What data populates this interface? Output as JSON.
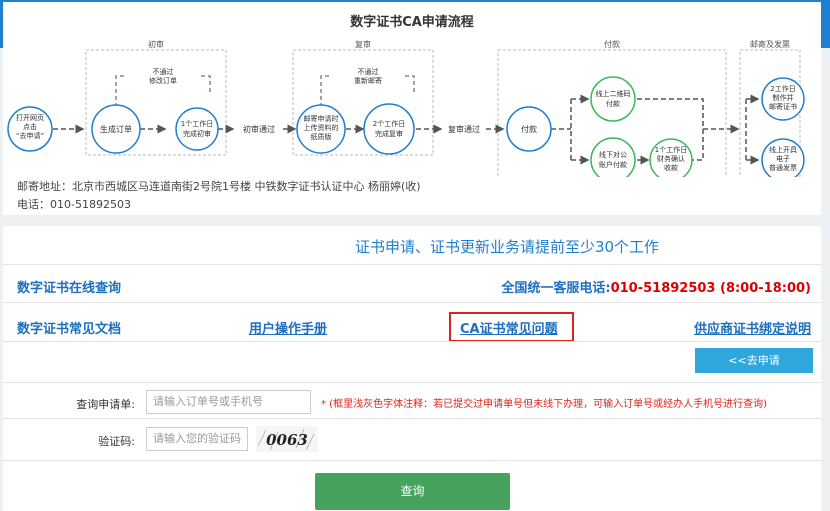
{
  "flow": {
    "title": "数字证书CA申请流程",
    "stages": {
      "first_review": "初审",
      "second_review": "复审",
      "payment": "付款",
      "mail": "邮寄及发票"
    },
    "start": [
      "打开网页",
      "点击",
      "“去申请”"
    ],
    "generate_order": "生成订单",
    "first_loop": [
      "不通过",
      "修改订单"
    ],
    "first_done": [
      "1个工作日",
      "完成初审"
    ],
    "first_pass": "初审通过",
    "mail_docs": [
      "邮寄申请时",
      "上传资料的",
      "纸质版"
    ],
    "second_loop": [
      "不通过",
      "重新邮寄"
    ],
    "second_done": [
      "2个工作日",
      "完成复审"
    ],
    "second_pass": "复审通过",
    "pay": "付款",
    "pay_online": [
      "线上二维码",
      "付款"
    ],
    "pay_offline": [
      "线下对公",
      "账户付款"
    ],
    "pay_confirm": [
      "1个工作日",
      "财务确认",
      "收款"
    ],
    "make_cert": [
      "2工作日",
      "制作并",
      "邮寄证书"
    ],
    "invoice": [
      "线上开具",
      "电子",
      "普通发票"
    ]
  },
  "address": {
    "line1": "邮寄地址：北京市西城区马连道南街2号院1号楼    中铁数字证书认证中心    杨丽婷(收)",
    "line2": "电话：010-51892503"
  },
  "notice": "证书申请、证书更新业务请提前至少30个工作",
  "links": {
    "online_query": "数字证书在线查询",
    "hotline_label": "全国统一客服电话:",
    "hotline_number": "010-51892503 (8:00-18:00)",
    "faq_docs": "数字证书常见文档",
    "manual": "用户操作手册",
    "ca_faq": "CA证书常见问题",
    "supplier_bind": "供应商证书绑定说明"
  },
  "apply_button": "<<去申请",
  "form": {
    "query_label": "查询申请单:",
    "query_placeholder": "请输入订单号或手机号",
    "hint": "* (框里浅灰色字体注释：若已提交过申请单号但未线下办理，可输入订单号或经办人手机号进行查询)",
    "captcha_label": "验证码:",
    "captcha_placeholder": "请输入您的验证码",
    "captcha_text": "0063",
    "submit": "查询"
  },
  "colors": {
    "accent_blue": "#1f7fd0",
    "flow_blue": "#1f7fd0",
    "flow_green": "#3cb95a",
    "hotline_red": "#dd0000",
    "highlight_border": "#d9261c",
    "query_button": "#46a35c",
    "apply_button": "#2fa6dc"
  }
}
